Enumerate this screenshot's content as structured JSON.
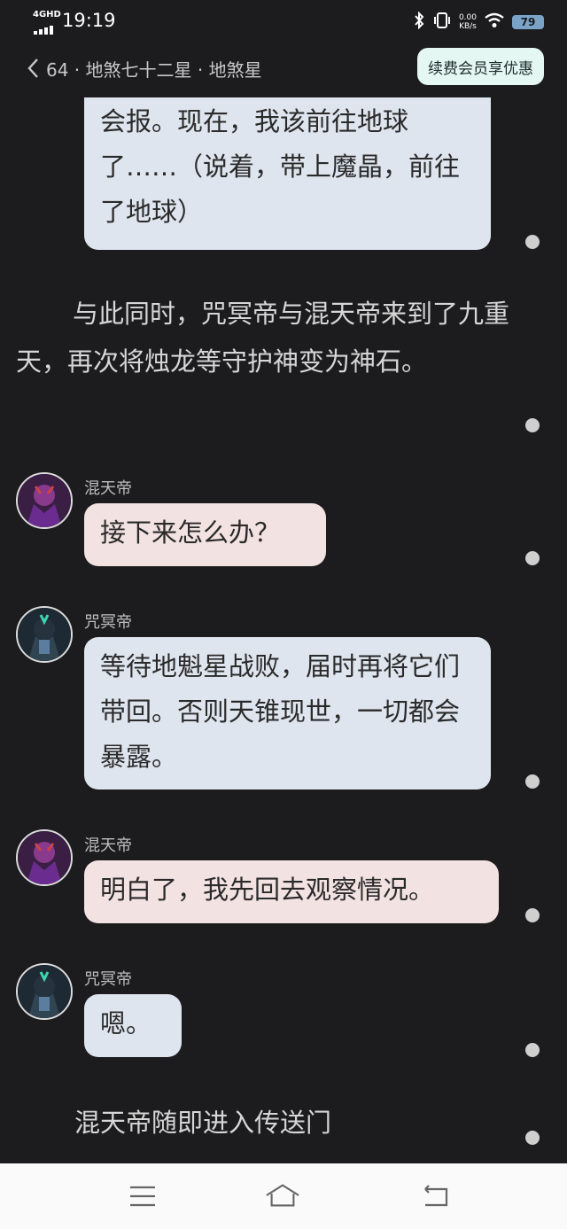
{
  "status": {
    "network": "4GHD",
    "time": "19:19",
    "speed_value": "0.00",
    "speed_unit": "KB/s",
    "battery": "79"
  },
  "header": {
    "title": "64 · 地煞七十二星 · 地煞星",
    "renew_label": "续费会员享优惠"
  },
  "chat": {
    "bubble_top": "会报。现在，我该前往地球了……（说着，带上魔晶，前往了地球）",
    "narration_1": "与此同时，咒冥帝与混天帝来到了九重天，再次将烛龙等守护神变为神石。",
    "msg1_name": "混天帝",
    "msg1_text": "接下来怎么办？",
    "msg2_name": "咒冥帝",
    "msg2_text": "等待地魁星战败，届时再将它们带回。否则天锥现世，一切都会暴露。",
    "msg3_name": "混天帝",
    "msg3_text": "明白了，我先回去观察情况。",
    "msg4_name": "咒冥帝",
    "msg4_text": "嗯。",
    "narration_2": "混天帝随即进入传送门"
  },
  "icons": {
    "back": "chevron-left-icon",
    "menu": "menu-icon",
    "home": "home-icon",
    "return": "return-icon",
    "bluetooth": "bluetooth-icon",
    "vibrate": "vibrate-icon",
    "wifi": "wifi-icon"
  },
  "colors": {
    "background": "#1c1c1e",
    "bubble_blue": "#dfe5ee",
    "bubble_pink": "#f3e2e2",
    "renew_button": "#e4f7f3"
  }
}
